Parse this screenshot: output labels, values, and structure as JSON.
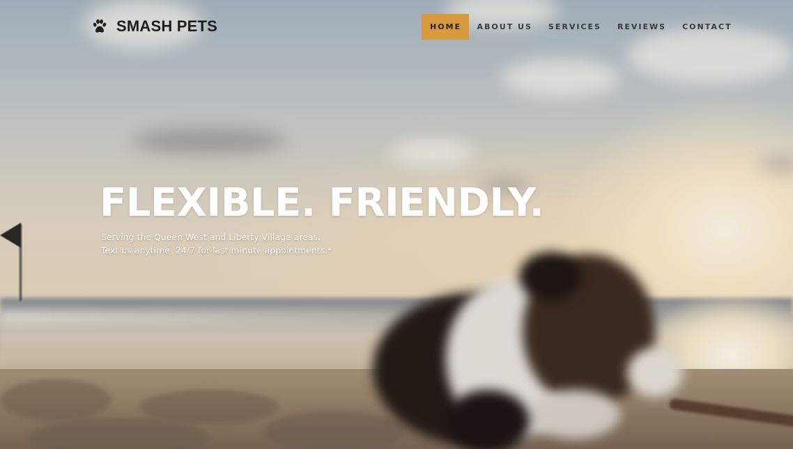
{
  "brand": {
    "name": "SMASH PETS",
    "logo_icon": "paw-icon"
  },
  "nav": {
    "items": [
      {
        "label": "HOME",
        "active": true
      },
      {
        "label": "ABOUT US",
        "active": false
      },
      {
        "label": "SERVICES",
        "active": false
      },
      {
        "label": "REVIEWS",
        "active": false
      },
      {
        "label": "CONTACT",
        "active": false
      }
    ],
    "active_color": "#d79a3f"
  },
  "hero": {
    "title": "FLEXIBLE. FRIENDLY.",
    "subtitle_line1": "Serving the Queen West and Liberty Village areas.",
    "subtitle_line2": "Text us anytime, 24/7 for last minute appointments.*",
    "background": "beach-sunset-dog-image"
  }
}
